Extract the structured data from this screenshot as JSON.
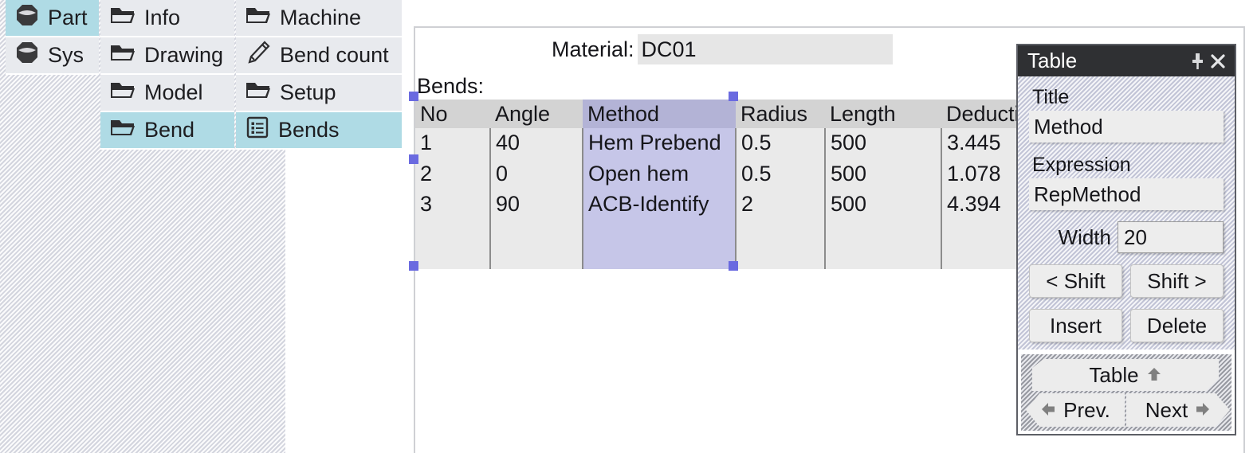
{
  "navigator": {
    "root_column": [
      {
        "label": "Part",
        "icon": "part-icon",
        "selected": true
      },
      {
        "label": "Sys",
        "icon": "sys-icon",
        "selected": false
      }
    ],
    "middle_column": [
      {
        "label": "Info",
        "icon": "folder-icon",
        "selected": false
      },
      {
        "label": "Drawing",
        "icon": "folder-icon",
        "selected": false
      },
      {
        "label": "Model",
        "icon": "folder-icon",
        "selected": false
      },
      {
        "label": "Bend",
        "icon": "folder-icon",
        "selected": true
      }
    ],
    "right_column": [
      {
        "label": "Machine",
        "icon": "folder-icon",
        "selected": false
      },
      {
        "label": "Bend count",
        "icon": "pencil-icon",
        "selected": false
      },
      {
        "label": "Setup",
        "icon": "folder-icon",
        "selected": false
      },
      {
        "label": "Bends",
        "icon": "list-icon",
        "selected": true
      }
    ]
  },
  "document": {
    "material_label": "Material:",
    "material_value": "DC01",
    "bends_label": "Bends:",
    "table": {
      "columns": [
        "No",
        "Angle",
        "Method",
        "Radius",
        "Length",
        "Deduction"
      ],
      "selected_column": "Method",
      "rows": [
        {
          "No": "1",
          "Angle": "40",
          "Method": "Hem Prebend",
          "Radius": "0.5",
          "Length": "500",
          "Deduction": "3.445"
        },
        {
          "No": "2",
          "Angle": "0",
          "Method": "Open hem",
          "Radius": "0.5",
          "Length": "500",
          "Deduction": "1.078"
        },
        {
          "No": "3",
          "Angle": "90",
          "Method": "ACB-Identify",
          "Radius": "2",
          "Length": "500",
          "Deduction": "4.394"
        }
      ]
    }
  },
  "panel": {
    "title": "Table",
    "pin_icon": "pin-icon",
    "close_icon": "close-icon",
    "title_field_label": "Title",
    "title_field_value": "Method",
    "expression_field_label": "Expression",
    "expression_field_value": "RepMethod",
    "width_label": "Width",
    "width_value": "20",
    "buttons": {
      "shift_left": "< Shift",
      "shift_right": "Shift >",
      "insert": "Insert",
      "delete": "Delete"
    },
    "nav": {
      "table": "Table",
      "table_icon": "arrow-up-icon",
      "prev": "Prev.",
      "prev_icon": "arrow-left-icon",
      "next": "Next",
      "next_icon": "arrow-right-icon"
    }
  },
  "colors": {
    "selection_blue": "#afdbe5",
    "column_select": "#c6c6e8",
    "handle": "#6a6ae0",
    "titlebar": "#2f3033"
  }
}
